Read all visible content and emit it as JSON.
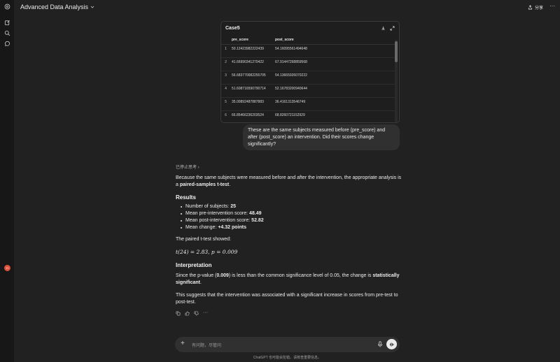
{
  "app": {
    "title": "Advanced Data Analysis",
    "share_label": "分享"
  },
  "card": {
    "title": "Case5",
    "columns": [
      "pre_score",
      "post_score"
    ],
    "rows": [
      {
        "idx": "1",
        "pre": "50.12423982222439",
        "post": "54.16095561494648"
      },
      {
        "idx": "2",
        "pre": "41.66990341270422",
        "post": "67.91447268859568"
      },
      {
        "idx": "3",
        "pre": "56.683770082255705",
        "post": "54.13665926070222"
      },
      {
        "idx": "4",
        "pre": "51.608716590790714",
        "post": "52.16783200940644"
      },
      {
        "idx": "5",
        "pre": "35.00892487887883",
        "post": "36.4161313546749"
      },
      {
        "idx": "6",
        "pre": "66.85466236203524",
        "post": "68.8260721152929"
      }
    ]
  },
  "user_message": "These are the same subjects measured before (pre_score) and after (post_score) an intervention. Did their scores change significantly?",
  "response": {
    "thinking": "已停止思考 ›",
    "intro_a": "Because the same subjects were measured before and after the intervention, the appropriate analysis is a ",
    "intro_b": "paired-samples t-test",
    "intro_c": ".",
    "results_heading": "Results",
    "bullets": [
      {
        "label": "Number of subjects: ",
        "value": "25"
      },
      {
        "label": "Mean pre-intervention score: ",
        "value": "48.49"
      },
      {
        "label": "Mean post-intervention score: ",
        "value": "52.82"
      },
      {
        "label": "Mean change: ",
        "value": "+4.32 points"
      }
    ],
    "ttest_intro": "The paired t-test showed:",
    "math": "t(24) = 2.83,  p = 0.009",
    "interp_heading": "Interpretation",
    "interp_a": "Since the p-value (",
    "interp_b": "0.009",
    "interp_c": ") is less than the common significance level of 0.05, the change is ",
    "interp_d": "statistically significant",
    "interp_e": ".",
    "conclusion": "This suggests that the intervention was associated with a significant increase in scores from pre-test to post-test."
  },
  "composer": {
    "placeholder": "有问题，尽管问"
  },
  "disclaimer": "ChatGPT 也可能会犯错。请核查重要信息。",
  "avatar_text": "H",
  "colors": {
    "avatar": "#e0533d",
    "bg": "#212121",
    "bubble": "#303030"
  }
}
